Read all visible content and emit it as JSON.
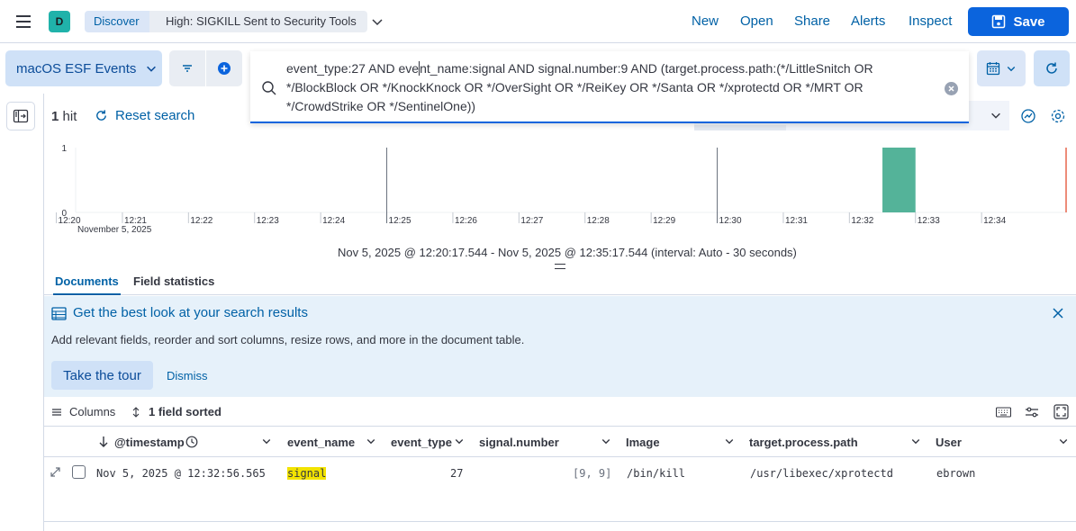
{
  "header": {
    "space_initial": "D",
    "breadcrumbs": [
      "Discover",
      "High: SIGKILL Sent to Security Tools"
    ],
    "links": [
      "New",
      "Open",
      "Share",
      "Alerts",
      "Inspect"
    ],
    "save_label": "Save"
  },
  "querybar": {
    "data_view": "macOS ESF Events",
    "query_before_cursor": "event_type:27 AND eve",
    "query_after_cursor": "nt_name:signal AND signal.number:9 AND (target.process.path:(*/LittleSnitch OR */BlockBlock OR */KnockKnock OR */OverSight OR */ReiKey OR */Santa OR */xprotectd OR */MRT OR */CrowdStrike OR */SentinelOne))"
  },
  "results": {
    "hit_count": "1",
    "hit_label": "hit",
    "reset_label": "Reset search"
  },
  "chart_data": {
    "type": "bar",
    "y_ticks": [
      "1",
      "0"
    ],
    "ylim": [
      0,
      1
    ],
    "x_ticks": [
      "12:20",
      "12:21",
      "12:22",
      "12:23",
      "12:24",
      "12:25",
      "12:26",
      "12:27",
      "12:28",
      "12:29",
      "12:30",
      "12:31",
      "12:32",
      "12:33",
      "12:34"
    ],
    "x_sublabel": "November 5, 2025",
    "bars": [
      {
        "x": "12:32:30",
        "value": 1
      }
    ],
    "bar_color": "#54b399",
    "range_label": "Nov 5, 2025 @ 12:20:17.544 - Nov 5, 2025 @ 12:35:17.544 (interval: Auto - 30 seconds)"
  },
  "tabs": [
    "Documents",
    "Field statistics"
  ],
  "callout": {
    "title": "Get the best look at your search results",
    "text": "Add relevant fields, reorder and sort columns, resize rows, and more in the document table.",
    "tour_label": "Take the tour",
    "dismiss_label": "Dismiss"
  },
  "table": {
    "columns_label": "Columns",
    "sort_label": "1 field sorted",
    "headers": [
      "@timestamp",
      "event_name",
      "event_type",
      "signal.number",
      "Image",
      "target.process.path",
      "User"
    ],
    "rows": [
      {
        "timestamp": "Nov 5, 2025 @ 12:32:56.565",
        "event_name": "signal",
        "event_type": "27",
        "signal_number": "[9, 9]",
        "image": "/bin/kill",
        "target_path": "/usr/libexec/xprotectd",
        "user": "ebrown"
      }
    ]
  },
  "colors": {
    "accent": "#0b64dd",
    "link": "#0061a6",
    "highlight": "#f2e300",
    "callout_bg": "#e6f1fa"
  }
}
